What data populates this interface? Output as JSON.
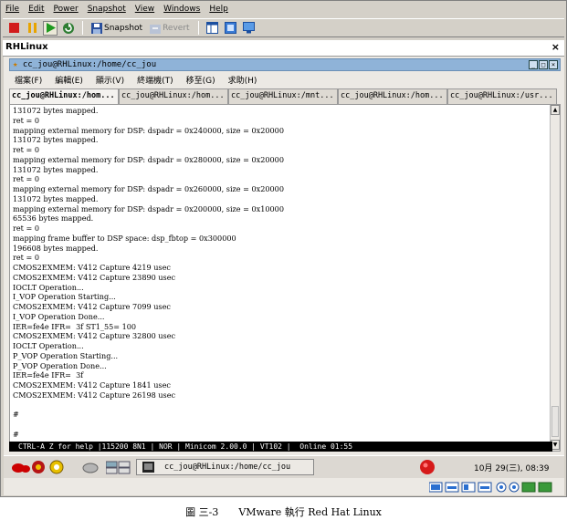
{
  "vmware": {
    "menu": [
      "File",
      "Edit",
      "Power",
      "Snapshot",
      "View",
      "Windows",
      "Help"
    ],
    "toolbar": {
      "snapshot_label": "Snapshot",
      "revert_label": "Revert"
    },
    "tab_label": "RHLinux",
    "close_glyph": "×"
  },
  "terminal": {
    "title": "cc_jou@RHLinux:/home/cc_jou",
    "menu": [
      "檔案(F)",
      "編輯(E)",
      "顯示(V)",
      "終端機(T)",
      "移至(G)",
      "求助(H)"
    ],
    "tabs": [
      "cc_jou@RHLinux:/hom...",
      "cc_jou@RHLinux:/hom...",
      "cc_jou@RHLinux:/mnt...",
      "cc_jou@RHLinux:/hom...",
      "cc_jou@RHLinux:/usr..."
    ],
    "lines": [
      "131072 bytes mapped.",
      "ret = 0",
      "mapping external memory for DSP: dspadr = 0x240000, size = 0x20000",
      "131072 bytes mapped.",
      "ret = 0",
      "mapping external memory for DSP: dspadr = 0x280000, size = 0x20000",
      "131072 bytes mapped.",
      "ret = 0",
      "mapping external memory for DSP: dspadr = 0x260000, size = 0x20000",
      "131072 bytes mapped.",
      "mapping external memory for DSP: dspadr = 0x200000, size = 0x10000",
      "65536 bytes mapped.",
      "ret = 0",
      "mapping frame buffer to DSP space: dsp_fbtop = 0x300000",
      "196608 bytes mapped.",
      "ret = 0",
      "CMOS2EXMEM: V412 Capture 4219 usec",
      "CMOS2EXMEM: V412 Capture 23890 usec",
      "IOCLT Operation...",
      "I_VOP Operation Starting...",
      "CMOS2EXMEM: V412 Capture 7099 usec",
      "I_VOP Operation Done...",
      "IER=fe4e IFR=  3f ST1_55= 100",
      "CMOS2EXMEM: V412 Capture 32800 usec",
      "IOCLT Operation...",
      "P_VOP Operation Starting...",
      "P_VOP Operation Done...",
      "IER=fe4e IFR=  3f",
      "CMOS2EXMEM: V412 Capture 1841 usec",
      "CMOS2EXMEM: V412 Capture 26198 usec",
      "",
      "#",
      "",
      "#"
    ],
    "status": "CTRL-A Z for help |115200 8N1 | NOR | Minicom 2.00.0 | VT102 |  Online 01:55"
  },
  "taskbar": {
    "window_label": "cc_jou@RHLinux:/home/cc_jou",
    "clock": "10月 29(三), 08:39"
  },
  "caption": "圖 三-3　　VMware 執行 Red Hat Linux"
}
